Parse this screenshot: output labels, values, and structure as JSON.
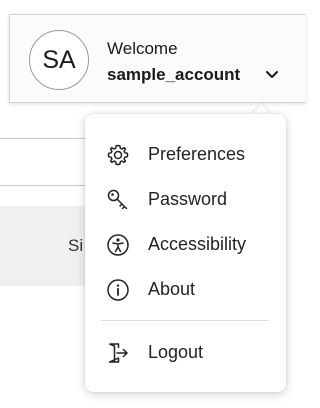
{
  "account": {
    "avatar_initials": "SA",
    "welcome_text": "Welcome",
    "username": "sample_account",
    "chevron_icon": "chevron-down-icon"
  },
  "background": {
    "panel_text": "Si"
  },
  "menu": {
    "items": [
      {
        "label": "Preferences",
        "icon": "gear-icon"
      },
      {
        "label": "Password",
        "icon": "key-icon"
      },
      {
        "label": "Accessibility",
        "icon": "accessibility-icon"
      },
      {
        "label": "About",
        "icon": "info-icon"
      }
    ],
    "logout": {
      "label": "Logout",
      "icon": "logout-icon"
    }
  },
  "colors": {
    "header_border": "#c8d6e3",
    "header_background": "#f9fbfd",
    "menu_background": "#ffffff",
    "text": "#222222"
  }
}
